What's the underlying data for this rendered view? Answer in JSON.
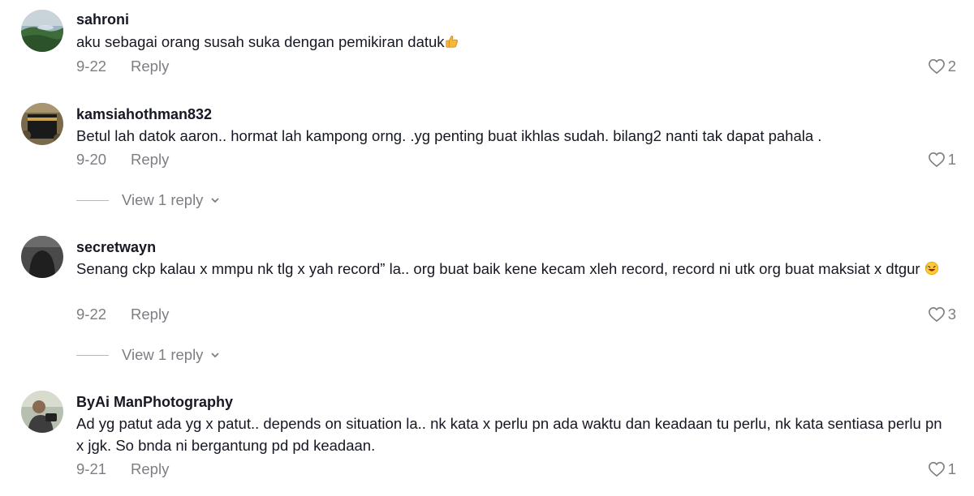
{
  "comments": [
    {
      "username": "sahroni",
      "text": "aku sebagai orang susah suka dengan pemikiran datuk",
      "emoji": "thumbs-up-icon",
      "date": "9-22",
      "reply_label": "Reply",
      "likes": "2"
    },
    {
      "username": "kamsiahothman832",
      "text": "Betul lah datok aaron.. hormat lah kampong orng. .yg penting buat ikhlas sudah. bilang2 nanti tak dapat pahala .",
      "date": "9-20",
      "reply_label": "Reply",
      "likes": "1",
      "view_replies": "View 1 reply"
    },
    {
      "username": "secretwayn",
      "text": "Senang ckp kalau x mmpu nk tlg x yah record” la.. org buat baik kene kecam xleh record, record ni utk org buat maksiat x dtgur",
      "emoji": "rolling-laughing-icon",
      "date": "9-22",
      "reply_label": "Reply",
      "likes": "3",
      "view_replies": "View 1 reply"
    },
    {
      "username": "ByAi ManPhotography",
      "text": "Ad yg patut ada yg x patut.. depends on situation la.. nk kata x perlu pn ada waktu dan keadaan tu perlu, nk kata sentiasa perlu pn x jgk. So bnda ni bergantung pd pd keadaan.",
      "date": "9-21",
      "reply_label": "Reply",
      "likes": "1"
    }
  ],
  "icons": {
    "like": "heart-outline-icon",
    "expand": "chevron-down-icon"
  },
  "colors": {
    "text": "#161823",
    "secondary": "#7d7e83"
  }
}
